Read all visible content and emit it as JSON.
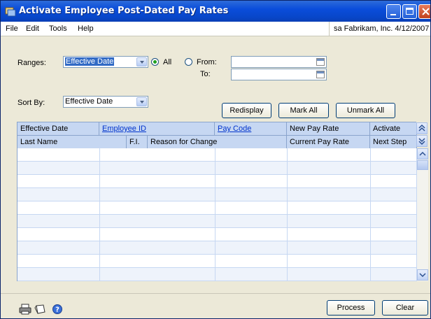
{
  "window": {
    "title": "Activate Employee Post-Dated Pay Rates"
  },
  "menu": {
    "items": [
      "File",
      "Edit",
      "Tools",
      "Help"
    ]
  },
  "user_info": "sa  Fabrikam, Inc.  4/12/2007",
  "ranges": {
    "label": "Ranges:",
    "selected": "Effective Date",
    "all_label": "All",
    "from_label": "From:",
    "to_label": "To:",
    "all_selected": true
  },
  "sort": {
    "label": "Sort By:",
    "selected": "Effective Date"
  },
  "buttons": {
    "redisplay": "Redisplay",
    "mark_all": "Mark All",
    "unmark_all": "Unmark All",
    "process": "Process",
    "clear": "Clear"
  },
  "grid": {
    "header_row1": [
      "Effective Date",
      "Employee ID",
      "Pay Code",
      "New Pay Rate",
      "Activate"
    ],
    "header_row2": [
      "Last Name",
      "F.I.",
      "Reason for Change",
      "Current Pay Rate",
      "Next Step"
    ],
    "rows": []
  },
  "colors": {
    "title_bar": "#0a4ddb",
    "grid_header": "#c6d7f2",
    "link": "#0033cc"
  },
  "icons": [
    "printer-icon",
    "note-icon",
    "help-icon",
    "calendar-icon",
    "expand-icon",
    "collapse-icon"
  ]
}
